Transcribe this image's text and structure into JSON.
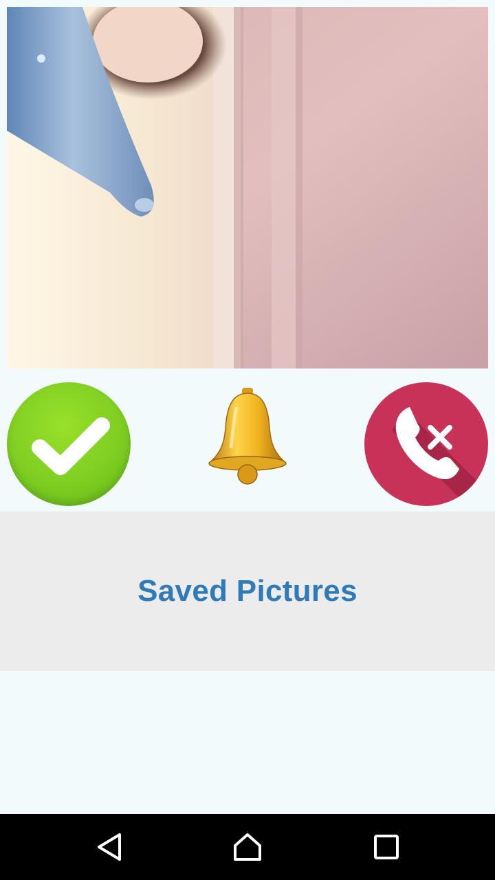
{
  "camera": {
    "icon": "camera-feed-image"
  },
  "actions": {
    "accept_icon": "checkmark-icon",
    "bell_icon": "bell-icon",
    "decline_icon": "phone-decline-icon"
  },
  "saved_pictures": {
    "label": "Saved Pictures"
  },
  "navigation": {
    "back_icon": "back-triangle-icon",
    "home_icon": "home-icon",
    "recents_icon": "recents-square-icon"
  },
  "colors": {
    "accept": "#7fce22",
    "decline": "#c83158",
    "bell": "#e0a820",
    "label": "#2e7bb8",
    "panel": "#ececec",
    "background": "#f3fafb"
  }
}
